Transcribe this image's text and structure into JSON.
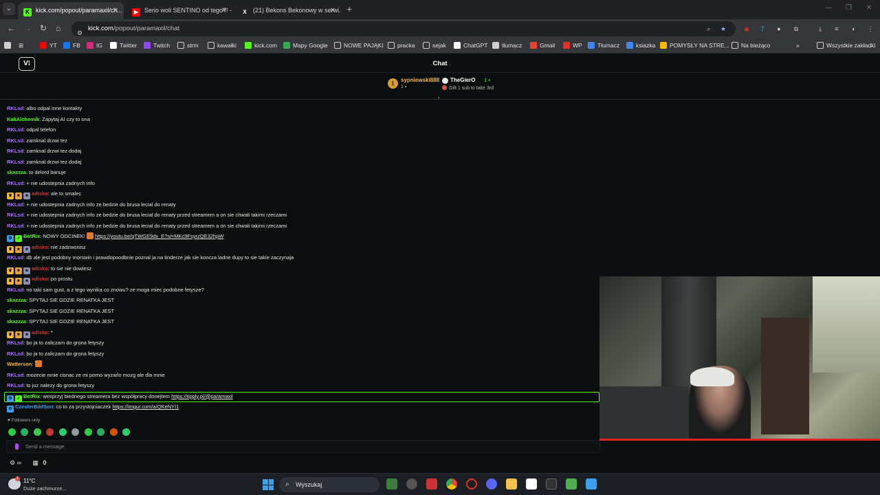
{
  "browser": {
    "tabs": [
      {
        "title": "kick.com/popout/paramaxil/ch...",
        "icon": "kick-icon",
        "active": true
      },
      {
        "title": "Serio woli SENTINO od tego?! -",
        "icon": "youtube-icon",
        "active": false
      },
      {
        "title": "(21) Bekons Bekonowy w serwi...",
        "icon": "x-icon",
        "active": false
      }
    ],
    "url_host": "kick.com",
    "url_path": "/popout/paramaxil/chat",
    "bookmarks": [
      {
        "label": "YT",
        "icon": "youtube-icon",
        "color": "#ff0000"
      },
      {
        "label": "FB",
        "icon": "facebook-icon",
        "color": "#1877f2"
      },
      {
        "label": "IG",
        "icon": "instagram-icon",
        "color": "#d62976"
      },
      {
        "label": "Twitter",
        "icon": "x-icon",
        "color": "#ffffff"
      },
      {
        "label": "Twitch",
        "icon": "twitch-icon",
        "color": "#9146ff"
      },
      {
        "label": "strm",
        "icon": "folder-icon",
        "color": "#cfcfcf"
      },
      {
        "label": "kawałki",
        "icon": "folder-icon",
        "color": "#cfcfcf"
      },
      {
        "label": "kick.com",
        "icon": "kick-icon",
        "color": "#53fc18"
      },
      {
        "label": "Mapy Google",
        "icon": "maps-icon",
        "color": "#34a853"
      },
      {
        "label": "NOWE PAJĄKI",
        "icon": "folder-icon",
        "color": "#cfcfcf"
      },
      {
        "label": "pracka",
        "icon": "folder-icon",
        "color": "#cfcfcf"
      },
      {
        "label": "sejak",
        "icon": "folder-icon",
        "color": "#cfcfcf"
      },
      {
        "label": "ChatGPT",
        "icon": "chatgpt-icon",
        "color": "#ffffff"
      },
      {
        "label": "tłumacz",
        "icon": "translate-icon",
        "color": "#cfcfcf"
      },
      {
        "label": "Gmail",
        "icon": "gmail-icon",
        "color": "#ea4335"
      },
      {
        "label": "WP",
        "icon": "wp-icon",
        "color": "#e0312b"
      },
      {
        "label": "Tłumacz",
        "icon": "translate-icon",
        "color": "#4285f4"
      },
      {
        "label": "ksiazka",
        "icon": "book-icon",
        "color": "#4285f4"
      },
      {
        "label": "POMYSŁY NA STRE...",
        "icon": "doc-icon",
        "color": "#fbbc04"
      },
      {
        "label": "Na bieżąco",
        "icon": "folder-icon",
        "color": "#cfcfcf"
      }
    ],
    "all_bookmarks": "Wszystkie zakładki"
  },
  "chat": {
    "title": "Chat",
    "pinned": {
      "leader_name": "sypniewski888",
      "leader_rank": "1",
      "leader_count": "1",
      "second_name": "TheGierO",
      "second_count": "1",
      "gift_text": "Gift 1 sub to take 3rd"
    },
    "messages": [
      {
        "user": "RKLsd",
        "color": "#b072ff",
        "text": ": albo odpal inne kontakty",
        "badges": []
      },
      {
        "user": "KaliAlchemik",
        "color": "#53fc18",
        "text": ": Zapytaj AI czy to ona",
        "badges": []
      },
      {
        "user": "RKLsd",
        "color": "#b072ff",
        "text": ": odpal telefon",
        "badges": []
      },
      {
        "user": "RKLsd",
        "color": "#b072ff",
        "text": ": zamknal drzwi tez",
        "badges": []
      },
      {
        "user": "RKLsd",
        "color": "#b072ff",
        "text": ": zamknal drzwi tez dodaj",
        "badges": []
      },
      {
        "user": "RKLsd",
        "color": "#b072ff",
        "text": ": zamknal drzwi tez dodaj",
        "badges": []
      },
      {
        "user": "skazzza",
        "color": "#53fc18",
        "text": ": to delord banuje",
        "badges": []
      },
      {
        "user": "RKLsd",
        "color": "#b072ff",
        "text": ": + nie udostepnia zadnych info",
        "badges": []
      },
      {
        "user": "adisko",
        "color": "#e0312b",
        "text": ": ale to smalec",
        "badges": [
          "crown",
          "gift",
          "sub"
        ]
      },
      {
        "user": "RKLsd",
        "color": "#b072ff",
        "text": ": + nie udostepnia zadnych info ze bedzie do brusa lecial do renaty",
        "badges": []
      },
      {
        "user": "RKLsd",
        "color": "#b072ff",
        "text": ": + nie udostepnia zadnych info ze bedzie do brusa lecial do renaty przed streamem a on sie chwali takimi rzeczami",
        "badges": []
      },
      {
        "user": "RKLsd",
        "color": "#b072ff",
        "text": ": + nie udostepnia zadnych info ze bedzie do brusa lecial do renaty przed streamem a on sie chwali takimi rzeczami",
        "badges": []
      },
      {
        "user": "BotRix",
        "color": "#53fc18",
        "text": ": NOWY ODCINEK! ",
        "link": "https://youtu.be/qTWGE9dx_E?si=MKc9FsyrzQE32hpW",
        "badges": [
          "bot",
          "verified"
        ],
        "emote": true
      },
      {
        "user": "adisko",
        "color": "#e0312b",
        "text": ": nie zadzwonisz",
        "badges": [
          "crown",
          "gift",
          "sub"
        ]
      },
      {
        "user": "RKLsd",
        "color": "#b072ff",
        "text": ": db ale jest podobny morswin i prawdopoodbnie poznal ja na tinderze jak sie koncza ladne dupy to sie takie zaczynaja",
        "badges": []
      },
      {
        "user": "adisko",
        "color": "#e0312b",
        "text": ": to sie nie dowiesz",
        "badges": [
          "crown",
          "gift",
          "sub"
        ]
      },
      {
        "user": "adisko",
        "color": "#e0312b",
        "text": ": po prostu",
        "badges": [
          "crown",
          "gift",
          "sub"
        ]
      },
      {
        "user": "RKLsd",
        "color": "#b072ff",
        "text": ": no taki sam gust, a z tego wynika co znowu? ze moga miec podobne fetysze?",
        "badges": []
      },
      {
        "user": "skazzza",
        "color": "#53fc18",
        "text": ": SPYTAJ SIE GDZIE RENATKA JEST",
        "badges": []
      },
      {
        "user": "skazzza",
        "color": "#53fc18",
        "text": ": SPYTAJ SIE GDZIE RENATKA JEST",
        "badges": []
      },
      {
        "user": "skazzza",
        "color": "#53fc18",
        "text": ": SPYTAJ SIE GDZIE RENATKA JEST",
        "badges": []
      },
      {
        "user": "adisko",
        "color": "#e0312b",
        "text": ": *",
        "badges": [
          "crown",
          "gift",
          "sub"
        ]
      },
      {
        "user": "RKLsd",
        "color": "#b072ff",
        "text": ": bo ja to zaliczam do grona fetyszy",
        "badges": []
      },
      {
        "user": "RKLsd",
        "color": "#b072ff",
        "text": ": bo ja to zaliczam do grona fetyszy",
        "badges": []
      },
      {
        "user": "Watterson",
        "color": "#f2b640",
        "text": ": ",
        "badges": [],
        "emote": true
      },
      {
        "user": "RKLsd",
        "color": "#b072ff",
        "text": ": mozecie mnie cisnac ze mi porno wyzarlo mozg ale dla mnie",
        "badges": []
      },
      {
        "user": "RKLsd",
        "color": "#b072ff",
        "text": ": to juz nalezy do grona fetyszy",
        "badges": []
      },
      {
        "user": "BotRix",
        "color": "#53fc18",
        "text": ": wesprzyj biednego streamera bez współpracy donejtem ",
        "link": "https://tipply.pl/@paramaxil",
        "badges": [
          "bot",
          "verified"
        ]
      },
      {
        "user": "CzesterBildSon",
        "color": "#3aa0f0",
        "text": ": co to za przystojniaczek ",
        "link": "https://imgur.com/a/QKeNYI1",
        "badges": [
          "bot"
        ]
      }
    ],
    "followers_only": "Followers only",
    "input_placeholder": "Send a message",
    "bottom_count": "0"
  },
  "taskbar": {
    "temperature": "11°C",
    "condition": "Duże zachmurze...",
    "search_label": "Wyszukaj"
  }
}
